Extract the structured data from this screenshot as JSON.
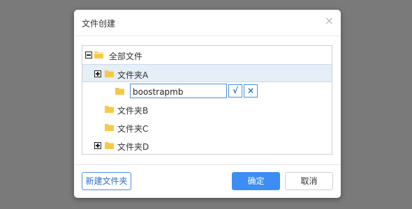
{
  "dialog": {
    "title": "文件创建",
    "close_glyph": "×"
  },
  "tree": {
    "root": {
      "label": "全部文件",
      "expanded": true,
      "icon": "folder-open-icon"
    },
    "items": [
      {
        "label": "文件夹A",
        "expandable": true,
        "selected": true,
        "icon": "folder-icon"
      },
      {
        "label": "文件夹B",
        "expandable": false,
        "icon": "folder-icon"
      },
      {
        "label": "文件夹C",
        "expandable": false,
        "icon": "folder-icon"
      },
      {
        "label": "文件夹D",
        "expandable": true,
        "icon": "folder-icon"
      }
    ],
    "new_folder_edit": {
      "value": "boostrapmb",
      "confirm_glyph": "√",
      "cancel_glyph": "×"
    }
  },
  "footer": {
    "new_folder_label": "新建文件夹",
    "ok_label": "确定",
    "cancel_label": "取消"
  },
  "colors": {
    "folder": "#f6c94a",
    "primary": "#3c8ef5",
    "selected_row": "#e6eef8",
    "backdrop": "#7a7a7a"
  }
}
